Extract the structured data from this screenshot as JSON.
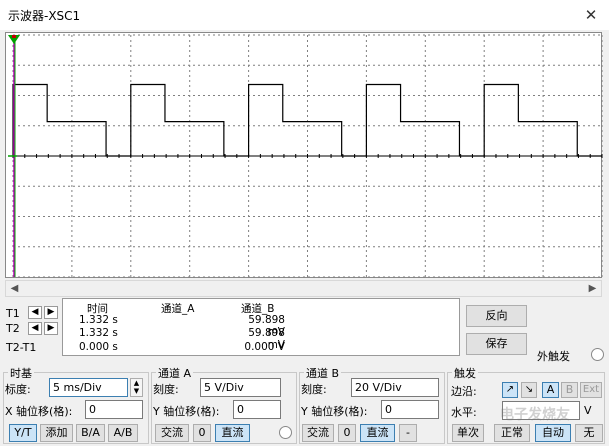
{
  "window": {
    "title": "示波器-XSC1",
    "close_glyph": "✕"
  },
  "screen": {
    "colors": {
      "background": "#ffffff",
      "grid": "#7f7f7f",
      "trace": "#000000",
      "cursor_t1": "#c000c0",
      "cursor_t2": "#00a000",
      "marker": "#c00000"
    },
    "trace_pattern": {
      "high": 2,
      "mid": 1,
      "low": 0
    }
  },
  "cursors": {
    "t1": "T1",
    "t2": "T2",
    "t2t1": "T2-T1",
    "headers": {
      "time": "时间",
      "channel_a": "通道_A",
      "channel_b": "通道_B"
    },
    "rows": [
      {
        "time": "1.332 s",
        "a": "",
        "b": "59.898 mV"
      },
      {
        "time": "1.332 s",
        "a": "",
        "b": "59.898 mV"
      },
      {
        "time": "0.000 s",
        "a": "",
        "b": "0.000 V"
      }
    ],
    "reverse_button": "反向",
    "save_button": "保存",
    "external_trigger": "外触发"
  },
  "timebase": {
    "group": "时基",
    "scale_label": "标度:",
    "scale_value": "5 ms/Div",
    "x_offset_label": "X 轴位移(格):",
    "x_offset_value": "0",
    "buttons": [
      "Y/T",
      "添加",
      "B/A",
      "A/B"
    ]
  },
  "channel_a": {
    "group": "通道 A",
    "scale_label": "刻度:",
    "scale_value": "5  V/Div",
    "y_offset_label": "Y 轴位移(格):",
    "y_offset_value": "0",
    "buttons": [
      "交流",
      "0",
      "直流"
    ]
  },
  "channel_b": {
    "group": "通道 B",
    "scale_label": "刻度:",
    "scale_value": "20  V/Div",
    "y_offset_label": "Y 轴位移(格):",
    "y_offset_value": "0",
    "buttons": [
      "交流",
      "0",
      "直流",
      "-"
    ]
  },
  "trigger": {
    "group": "触发",
    "edge_label": "边沿:",
    "edge_buttons": [
      "↗",
      "↘",
      "A",
      "B",
      "Ext"
    ],
    "level_label": "水平:",
    "level_value": "V",
    "mode_buttons": [
      "单次",
      "正常",
      "自动",
      "无"
    ]
  },
  "watermark": "电子发烧友"
}
